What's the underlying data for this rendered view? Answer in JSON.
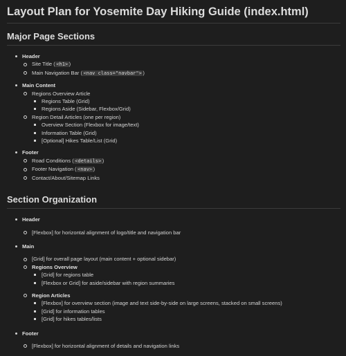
{
  "title": "Layout Plan for Yosemite Day Hiking Guide (index.html)",
  "section1": {
    "heading": "Major Page Sections",
    "header": {
      "label": "Header",
      "site_title_text": "Site Title (",
      "site_title_code": "<h1>",
      "site_title_end": ")",
      "nav_text": "Main Navigation Bar (",
      "nav_code": "<nav class=\"navbar\">",
      "nav_end": ")"
    },
    "main": {
      "label": "Main Content",
      "regions_overview": "Regions Overview Article",
      "regions_table": "Regions Table (Grid)",
      "regions_aside": "Regions Aside (Sidebar, Flexbox/Grid)",
      "region_detail": "Region Detail Articles (one per region)",
      "overview_section": "Overview Section (Flexbox for image/text)",
      "information_table": "Information Table (Grid)",
      "hikes_table": "[Optional] Hikes Table/List (Grid)"
    },
    "footer": {
      "label": "Footer",
      "road_text": "Road Conditions (",
      "road_code": "<details>",
      "road_end": ")",
      "footer_nav_text": "Footer Navigation (",
      "footer_nav_code": "<nav>",
      "footer_nav_end": ")",
      "contact": "Contact/About/Sitemap Links"
    }
  },
  "section2": {
    "heading": "Section Organization",
    "header": {
      "label": "Header",
      "item": "[Flexbox] for horizontal alignment of logo/title and navigation bar"
    },
    "main": {
      "label": "Main",
      "grid_item": "[Grid] for overall page layout (main content + optional sidebar)",
      "regions_overview_label": "Regions Overview",
      "regions_grid": "[Grid] for regions table",
      "regions_flex": "[Flexbox or Grid] for aside/sidebar with region summaries",
      "region_articles_label": "Region Articles",
      "ra_flex": "[Flexbox] for overview section (image and text side-by-side on large screens, stacked on small screens)",
      "ra_grid_info": "[Grid] for information tables",
      "ra_grid_hikes": "[Grid] for hikes tables/lists"
    },
    "footer": {
      "label": "Footer",
      "item": "[Flexbox] for horizontal alignment of details and navigation links"
    }
  }
}
